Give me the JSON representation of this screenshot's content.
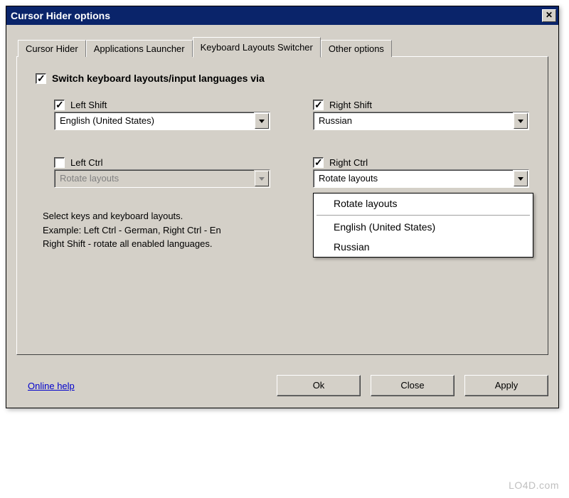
{
  "window": {
    "title": "Cursor Hider options"
  },
  "tabs": {
    "t0": "Cursor Hider",
    "t1": "Applications Launcher",
    "t2": "Keyboard Layouts Switcher",
    "t3": "Other options"
  },
  "main_checkbox_label": "Switch keyboard layouts/input languages via",
  "fields": {
    "left_shift": {
      "label": "Left Shift",
      "value": "English (United States)"
    },
    "right_shift": {
      "label": "Right Shift",
      "value": "Russian"
    },
    "left_ctrl": {
      "label": "Left Ctrl",
      "value": "Rotate layouts"
    },
    "right_ctrl": {
      "label": "Right Ctrl",
      "value": "Rotate layouts"
    }
  },
  "dropdown": {
    "opt0": "Rotate layouts",
    "opt1": "English (United States)",
    "opt2": "Russian"
  },
  "help_text": "Select keys and keyboard layouts.\nExample: Left Ctrl - German, Right Ctrl - En\nRight Shift - rotate all enabled languages.",
  "bottom": {
    "online_help": "Online help",
    "ok": "Ok",
    "close": "Close",
    "apply": "Apply"
  },
  "watermark": "LO4D.com"
}
